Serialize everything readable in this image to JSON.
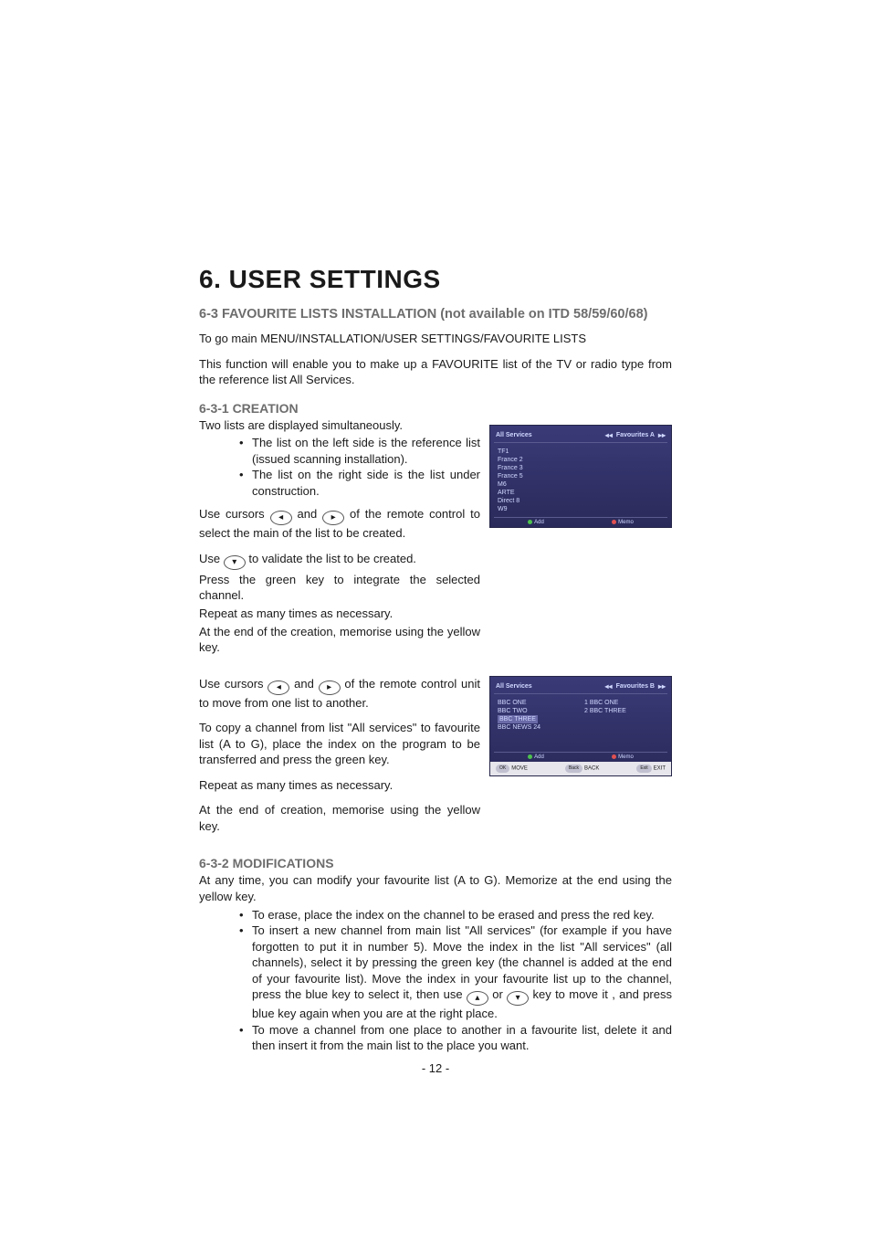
{
  "title": "6. USER SETTINGS",
  "subtitle": "6-3 FAVOURITE LISTS INSTALLATION (not available on ITD 58/59/60/68)",
  "path_line": "To go main MENU/INSTALLATION/USER SETTINGS/FAVOURITE LISTS",
  "intro": "This function will enable you to make up a FAVOURITE list of the TV or radio type from the reference list All Services.",
  "sec1": {
    "heading": "6-3-1 CREATION",
    "line_intro": "Two lists are displayed simultaneously.",
    "bullets": [
      "The list on the left side is the reference list (issued scanning installation).",
      "The list on the right side is the list under construction."
    ],
    "p1a": "Use cursors ",
    "p1b": " and ",
    "p1c": " of the remote control to select the main of the list to be created.",
    "p2a": "Use ",
    "p2b": " to validate the list to be created.",
    "p3": "Press the green key to integrate the selected channel.",
    "p4": "Repeat as many times as necessary.",
    "p5": "At the end of the creation, memorise using the yellow key.",
    "p6a": "Use cursors ",
    "p6b": " and ",
    "p6c": " of the remote control unit to move from one list to another.",
    "p7": "To copy a channel from list \"All services\" to favourite list (A to G), place the index on the program to be transferred and press the green key.",
    "p8": "Repeat as many times as necessary.",
    "p9": "At the end of creation, memorise using the yellow key."
  },
  "sec2": {
    "heading": "6-3-2 MODIFICATIONS",
    "line_intro": "At any time, you can modify your favourite list (A to G). Memorize at the end using the yellow key.",
    "b1": "To erase, place the index on the channel to be erased and press the red key.",
    "b2a": "To insert a new channel from main list \"All services\" (for example if you have forgotten to put it in number 5). Move the index in the list \"All services\" (all channels), select it by pressing the green key (the channel is added at the end of your favourite list). Move the index in your favourite list up to the channel, press the blue key to select it, then use ",
    "b2b": " or ",
    "b2c": " key to move it , and press blue key again when you are at the right place.",
    "b3": "To move a channel from one place to another in a favourite list, delete it and then insert it from the main list to the place you want."
  },
  "keys": {
    "left": "◂",
    "right": "▸",
    "down": "▾",
    "up": "▴"
  },
  "screenshot1": {
    "left_title": "All Services",
    "right_title": "Favourites A",
    "arr_l": "◂◂",
    "arr_r": "▸▸",
    "channels": [
      "TF1",
      "France 2",
      "France 3",
      "France 5",
      "M6",
      "ARTE",
      "Direct 8",
      "W9"
    ],
    "foot_add": "Add",
    "foot_memo": "Memo"
  },
  "screenshot2": {
    "left_title": "All Services",
    "right_title": "Favourites B",
    "arr_l": "◂◂",
    "arr_r": "▸▸",
    "left_channels": [
      "BBC ONE",
      "BBC TWO",
      "BBC THREE",
      "BBC NEWS 24"
    ],
    "right_channels": [
      "1 BBC ONE",
      "2 BBC THREE"
    ],
    "foot_add": "Add",
    "foot_memo": "Memo",
    "hint_move": "MOVE",
    "hint_back": "BACK",
    "hint_exit": "EXIT",
    "pill_ok": "OK",
    "pill_back": "Back",
    "pill_exit": "Exit"
  },
  "page_number": "- 12 -"
}
